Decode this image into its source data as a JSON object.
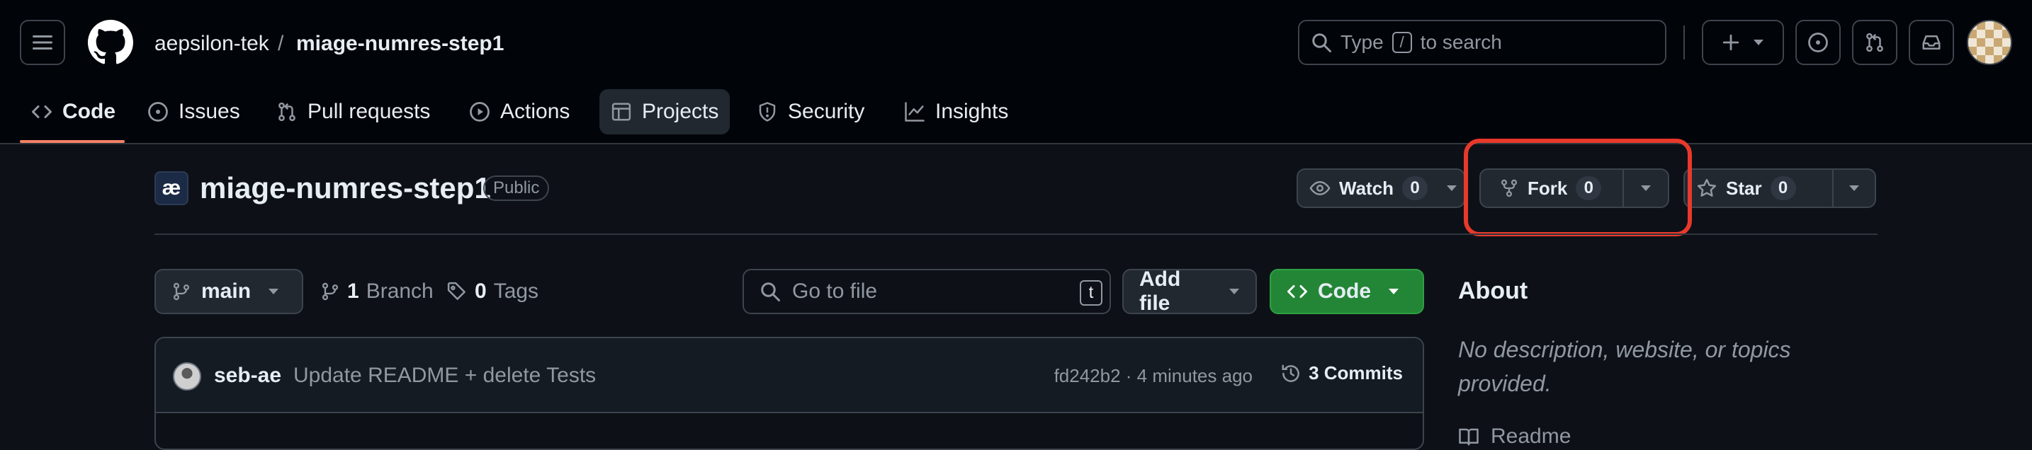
{
  "header": {
    "owner": "aepsilon-tek",
    "separator": "/",
    "repo": "miage-numres-step1",
    "search": {
      "before": "Type",
      "key": "/",
      "after": "to search"
    }
  },
  "nav": {
    "tabs": [
      {
        "label": "Code",
        "icon": "code-icon",
        "selected": true
      },
      {
        "label": "Issues",
        "icon": "issue-opened-icon"
      },
      {
        "label": "Pull requests",
        "icon": "git-pull-request-icon"
      },
      {
        "label": "Actions",
        "icon": "play-icon"
      },
      {
        "label": "Projects",
        "icon": "table-icon"
      },
      {
        "label": "Security",
        "icon": "shield-icon"
      },
      {
        "label": "Insights",
        "icon": "graph-icon"
      }
    ]
  },
  "repo": {
    "logo_text": "æ",
    "title": "miage-numres-step1",
    "visibility": "Public",
    "watch": {
      "label": "Watch",
      "count": "0"
    },
    "fork": {
      "label": "Fork",
      "count": "0"
    },
    "star": {
      "label": "Star",
      "count": "0"
    }
  },
  "toolbar": {
    "branch": "main",
    "branches": {
      "count": "1",
      "label": "Branch"
    },
    "tags": {
      "count": "0",
      "label": "Tags"
    },
    "goto_placeholder": "Go to file",
    "goto_key": "t",
    "add_file": "Add file",
    "code": "Code"
  },
  "commit": {
    "author": "seb-ae",
    "message": "Update README + delete Tests",
    "meta": "fd242b2 · 4 minutes ago",
    "commits_label": "3 Commits"
  },
  "about": {
    "title": "About",
    "description": "No description, website, or topics provided.",
    "readme": "Readme"
  },
  "colors": {
    "background": "#0d1117",
    "header_bg": "#010409",
    "primary_button": "#238636",
    "highlight": "#e8392b",
    "tab_underline": "#f78166"
  }
}
